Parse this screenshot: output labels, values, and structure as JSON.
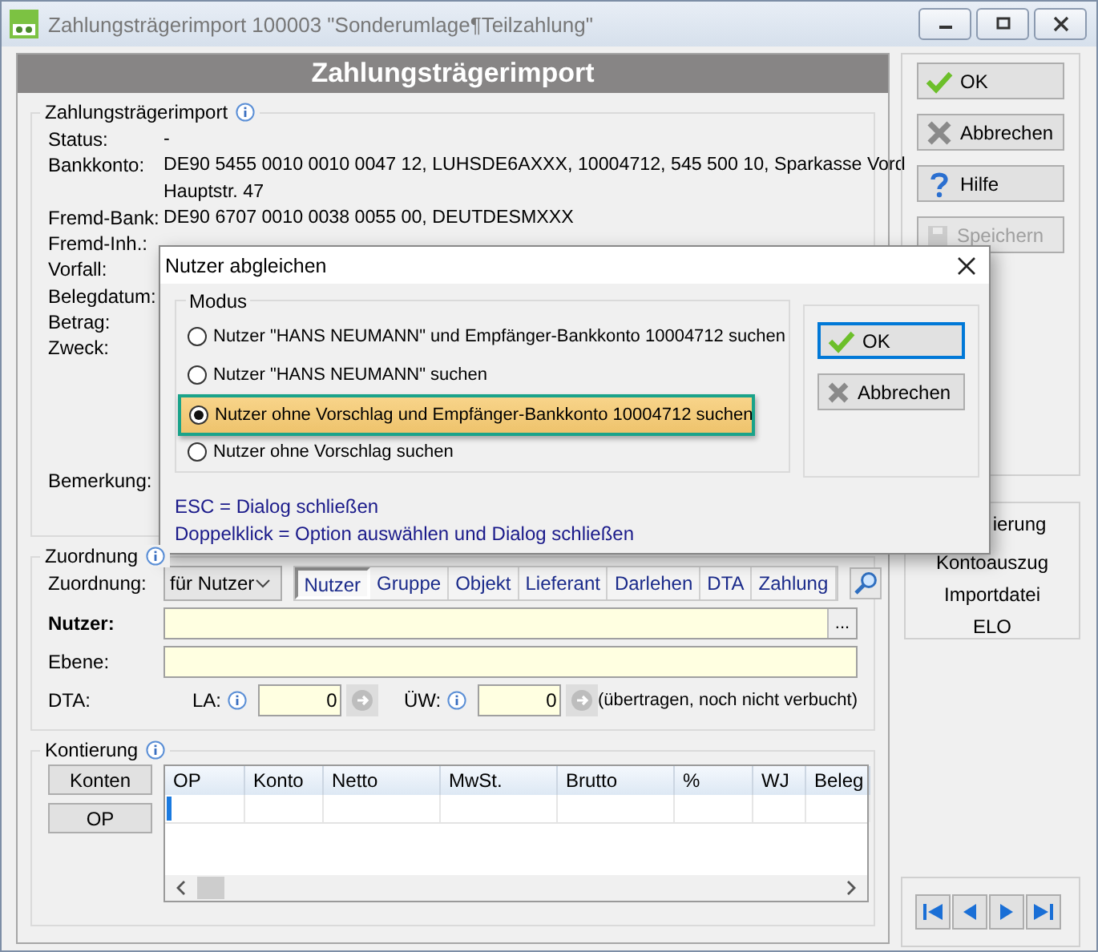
{
  "window": {
    "title": "Zahlungsträgerimport 100003 \"Sonderumlage¶Teilzahlung\""
  },
  "header": {
    "title": "Zahlungsträgerimport"
  },
  "import_group": {
    "title": "Zahlungsträgerimport",
    "fields": [
      {
        "label": "Status:",
        "lines": [
          "-"
        ]
      },
      {
        "label": "Bankkonto:",
        "lines": [
          "DE90 5455 0010 0010 0047 12,  LUHSDE6AXXX,  10004712,  545 500 10,  Sparkasse Vord",
          "Hauptstr. 47"
        ]
      },
      {
        "label": "Fremd-Bank:",
        "lines": [
          "DE90 6707 0010 0038 0055 00,  DEUTDESMXXX"
        ]
      },
      {
        "label": "Fremd-Inh.:"
      },
      {
        "label": "Vorfall:"
      },
      {
        "label": "Belegdatum:"
      },
      {
        "label": "Betrag:"
      },
      {
        "label": "Zweck:"
      }
    ],
    "remark_label": "Bemerkung:"
  },
  "side_buttons": [
    {
      "kind": "ok",
      "label": "OK",
      "disabled": false
    },
    {
      "kind": "cancel",
      "label": "Abbrechen",
      "disabled": false
    },
    {
      "kind": "help",
      "label": "Hilfe",
      "disabled": false
    },
    {
      "kind": "save",
      "label": "Speichern",
      "disabled": true
    }
  ],
  "side_links": [
    "ierung",
    "Kontoauszug",
    "Importdatei",
    "ELO"
  ],
  "zuordnung": {
    "title": "Zuordnung",
    "label": "Zuordnung:",
    "select": "für Nutzer",
    "tabs": [
      {
        "label": "Nutzer",
        "selected": true
      },
      {
        "label": "Gruppe",
        "selected": false
      },
      {
        "label": "Objekt",
        "selected": false
      },
      {
        "label": "Lieferant",
        "selected": false
      },
      {
        "label": "Darlehen",
        "selected": false
      },
      {
        "label": "DTA",
        "selected": false
      },
      {
        "label": "Zahlung",
        "selected": false
      }
    ],
    "nutzer_label": "Nutzer:",
    "browse": "...",
    "ebene_label": "Ebene:",
    "dta_label": "DTA:",
    "la_label": "LA:",
    "la_value": "0",
    "uw_label": "ÜW:",
    "uw_value": "0",
    "note": "(übertragen, noch nicht verbucht)"
  },
  "kontierung": {
    "title": "Kontierung",
    "buttons": [
      "Konten",
      "OP"
    ],
    "columns": [
      "OP",
      "Konto",
      "Netto",
      "MwSt.",
      "Brutto",
      "%",
      "WJ",
      "Beleg"
    ]
  },
  "dialog": {
    "title": "Nutzer abgleichen",
    "group": "Modus",
    "options": [
      {
        "label": "Nutzer \"HANS NEUMANN\" und Empfänger-Bankkonto 10004712 suchen",
        "selected": false,
        "highlighted": false
      },
      {
        "label": "Nutzer \"HANS NEUMANN\" suchen",
        "selected": false,
        "highlighted": false
      },
      {
        "label": "Nutzer ohne Vorschlag und Empfänger-Bankkonto 10004712 suchen",
        "selected": true,
        "highlighted": true
      },
      {
        "label": "Nutzer ohne Vorschlag suchen",
        "selected": false,
        "highlighted": false
      }
    ],
    "buttons": [
      {
        "kind": "ok",
        "label": "OK"
      },
      {
        "kind": "cancel",
        "label": "Abbrechen"
      }
    ],
    "hints": [
      "ESC = Dialog schließen",
      "Doppelklick = Option auswählen und Dialog schließen"
    ]
  }
}
